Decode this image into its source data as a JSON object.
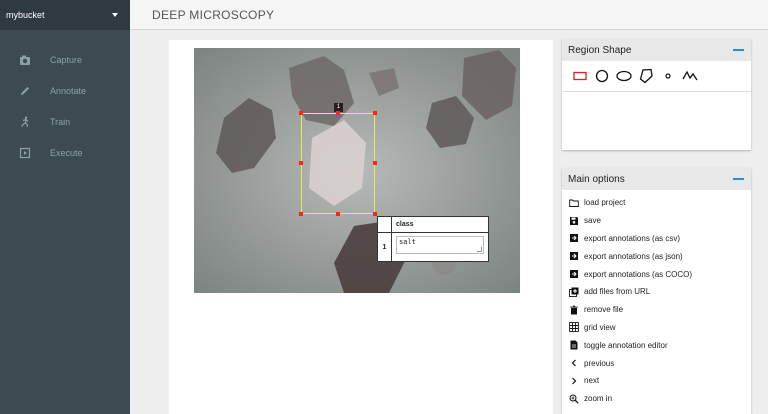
{
  "sidebar": {
    "bucket": "mybucket",
    "items": [
      {
        "label": "Capture",
        "icon": "camera-icon"
      },
      {
        "label": "Annotate",
        "icon": "pencil-icon"
      },
      {
        "label": "Train",
        "icon": "running-figure-icon"
      },
      {
        "label": "Execute",
        "icon": "play-document-icon"
      }
    ]
  },
  "header": {
    "title": "DEEP MICROSCOPY"
  },
  "canvas": {
    "region_id": "1",
    "attributes": {
      "column": "class",
      "row_id": "1",
      "value": "salt"
    },
    "colors": {
      "bbox": "#f4e94a",
      "handle": "#ff2020"
    }
  },
  "region_shape": {
    "title": "Region Shape",
    "shapes": [
      "rectangle-icon",
      "circle-icon",
      "ellipse-icon",
      "polygon-icon",
      "point-icon",
      "polyline-icon"
    ],
    "selected_color": "#e02020"
  },
  "main_options": {
    "title": "Main options",
    "items": [
      {
        "label": "load project",
        "icon": "folder-icon"
      },
      {
        "label": "save",
        "icon": "floppy-icon"
      },
      {
        "label": "export annotations (as csv)",
        "icon": "export-icon"
      },
      {
        "label": "export annotations (as json)",
        "icon": "export-icon"
      },
      {
        "label": "export annotations (as COCO)",
        "icon": "export-icon"
      },
      {
        "label": "add files from URL",
        "icon": "add-library-icon"
      },
      {
        "label": "remove file",
        "icon": "trash-icon"
      },
      {
        "label": "grid view",
        "icon": "grid-icon"
      },
      {
        "label": "toggle annotation editor",
        "icon": "document-icon"
      },
      {
        "label": "previous",
        "icon": "chevron-left-icon"
      },
      {
        "label": "next",
        "icon": "chevron-right-icon"
      },
      {
        "label": "zoom in",
        "icon": "zoom-in-icon"
      }
    ]
  },
  "accent": "#2a8ad4",
  "sidebar_color": "#3c4b52"
}
